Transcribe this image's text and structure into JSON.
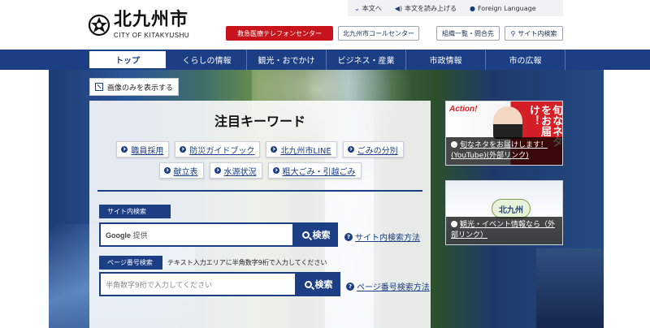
{
  "header": {
    "logo_ja": "北九州市",
    "logo_en": "CITY OF KITAKYUSHU",
    "toplinks": [
      {
        "icon": "chevron-down-icon",
        "label": "本文へ"
      },
      {
        "icon": "speaker-icon",
        "label": "本文を読み上げる"
      },
      {
        "icon": "globe-icon",
        "label": "Foreign Language"
      }
    ],
    "emergency_btn": "救急医療テレフォンセンター",
    "callcenter_btn": "北九州市コールセンター",
    "org_btn": "組織一覧・問合先",
    "sitesearch_btn": "サイト内検索"
  },
  "nav": {
    "items": [
      "トップ",
      "くらしの情報",
      "観光・おでかけ",
      "ビジネス・産業",
      "市政情報",
      "市の広報"
    ],
    "active": "トップ"
  },
  "hero": {
    "image_only_btn": "画像のみを表示する"
  },
  "keywords": {
    "title": "注目キーワード",
    "row1": [
      "職員採用",
      "防災ガイドブック",
      "北九州市LINE",
      "ごみの分別"
    ],
    "row2": [
      "献立表",
      "水源状況",
      "粗大ごみ・引越ごみ"
    ]
  },
  "search": {
    "site_label": "サイト内検索",
    "google_text": "Google",
    "google_sub": "提供",
    "button": "検索",
    "site_howto": "サイト内検索方法",
    "page_label": "ページ番号検索",
    "page_hint": "テキスト入力エリアに半角数字9桁で入力してください",
    "page_placeholder": "半角数字9桁で入力してください",
    "page_button": "検索",
    "page_howto": "ページ番号検索方法"
  },
  "banners": [
    {
      "brand": "Action!",
      "vtext": "旬なネタをお届け！",
      "caption": "旬なネタをお届けします！(YouTube)(外部リンク)"
    },
    {
      "badge": "北九州",
      "caption": "観光・イベント情報なら（外部リンク）"
    }
  ],
  "colors": {
    "brand_navy": "#1c3e85",
    "emergency_red": "#c8151d"
  }
}
